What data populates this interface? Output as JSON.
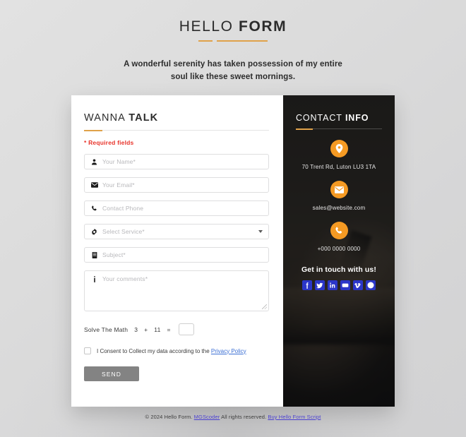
{
  "header": {
    "logo_light": "HELLO ",
    "logo_bold": "FORM",
    "subtitle": "A wonderful serenity has taken possession of my entire soul like these sweet mornings."
  },
  "form": {
    "title_light": "WANNA ",
    "title_bold": "TALK",
    "required_note": "* Required fields",
    "fields": [
      {
        "icon": "user-icon",
        "placeholder": "Your Name*"
      },
      {
        "icon": "envelope-icon",
        "placeholder": "Your Email*"
      },
      {
        "icon": "phone-icon",
        "placeholder": "Contact Phone"
      },
      {
        "icon": "gear-icon",
        "placeholder": "Select Service*"
      },
      {
        "icon": "book-icon",
        "placeholder": "Subject*"
      },
      {
        "icon": "info-icon",
        "placeholder": "Your comments*"
      }
    ],
    "math": {
      "label": "Solve The Math",
      "operand_a": "3",
      "operator": "+",
      "operand_b": "11",
      "equals": "=",
      "answer_value": ""
    },
    "consent": {
      "text": "I Consent to Collect my data according to the ",
      "link_label": "Privacy Policy"
    },
    "send_label": "SEND"
  },
  "contact": {
    "title_light": "CONTACT ",
    "title_bold": "INFO",
    "items": [
      {
        "icon": "location-pin-icon",
        "text": "70 Trent Rd, Luton LU3 1TA"
      },
      {
        "icon": "envelope-icon",
        "text": "sales@website.com"
      },
      {
        "icon": "phone-icon",
        "text": "+000 0000 0000"
      }
    ],
    "social_title": "Get in touch with us!",
    "social": [
      {
        "name": "facebook-icon",
        "color": "#2b36c8"
      },
      {
        "name": "twitter-icon",
        "color": "#2b36c8"
      },
      {
        "name": "linkedin-icon",
        "color": "#2b36c8"
      },
      {
        "name": "youtube-icon",
        "color": "#2b36c8"
      },
      {
        "name": "vimeo-icon",
        "color": "#2b36c8"
      },
      {
        "name": "pinterest-icon",
        "color": "#2b36c8"
      }
    ]
  },
  "footer": {
    "copyright": "© 2024 Hello Form. ",
    "link_author": "MGScoder",
    "rights": " All rights reserved. ",
    "link_buy": "Buy Hello Form Script"
  },
  "colors": {
    "accent_orange": "#f59a23",
    "rule_orange": "#e0a24a",
    "required_red": "#e8332a",
    "send_gray": "#838383",
    "link_blue": "#3b6fd4",
    "footer_link": "#4a3fd0",
    "panel_dark": "#1f1f1f"
  }
}
